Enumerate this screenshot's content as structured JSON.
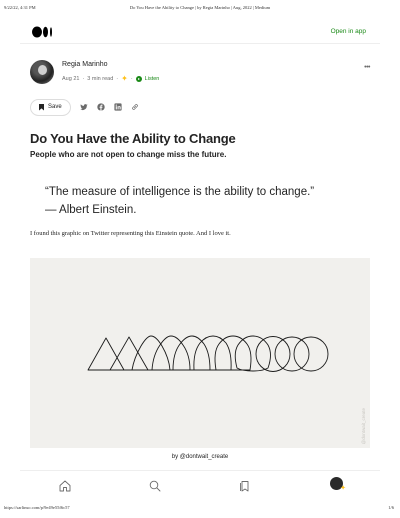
{
  "print": {
    "date": "9/22/22, 4:31 PM",
    "title": "Do You Have the Ability to Change | by Regia Marinho | Aug, 2022 | Medium",
    "url": "https://sarlinso.com/p/9e49e55f6c57",
    "page": "1/6"
  },
  "topbar": {
    "logo_icon": "medium-logo-icon",
    "open_app_label": "Open in app",
    "accent": "#1a8917"
  },
  "author": {
    "name": "Regia Marinho",
    "date": "Aug 21",
    "read_time": "3 min read",
    "dot": "·",
    "listen_label": "Listen",
    "more_label": "•••"
  },
  "actions": {
    "save_label": "Save",
    "icons": [
      "twitter-icon",
      "facebook-icon",
      "linkedin-icon",
      "link-icon"
    ]
  },
  "article": {
    "title": "Do You Have the Ability to Change",
    "subtitle": "People who are not open to change miss the future.",
    "quote_line1": "“The measure of intelligence is the ability to change.”",
    "quote_line2": "— Albert Einstein.",
    "body": "I found this graphic on Twitter representing this Einstein quote. And I love it."
  },
  "figure": {
    "watermark": "@dontwait_create",
    "caption": "by @dontwait_create",
    "background": "#f1f0ed"
  },
  "bottom_nav": {
    "items": [
      "home-icon",
      "search-icon",
      "lists-icon",
      "profile-avatar"
    ]
  }
}
